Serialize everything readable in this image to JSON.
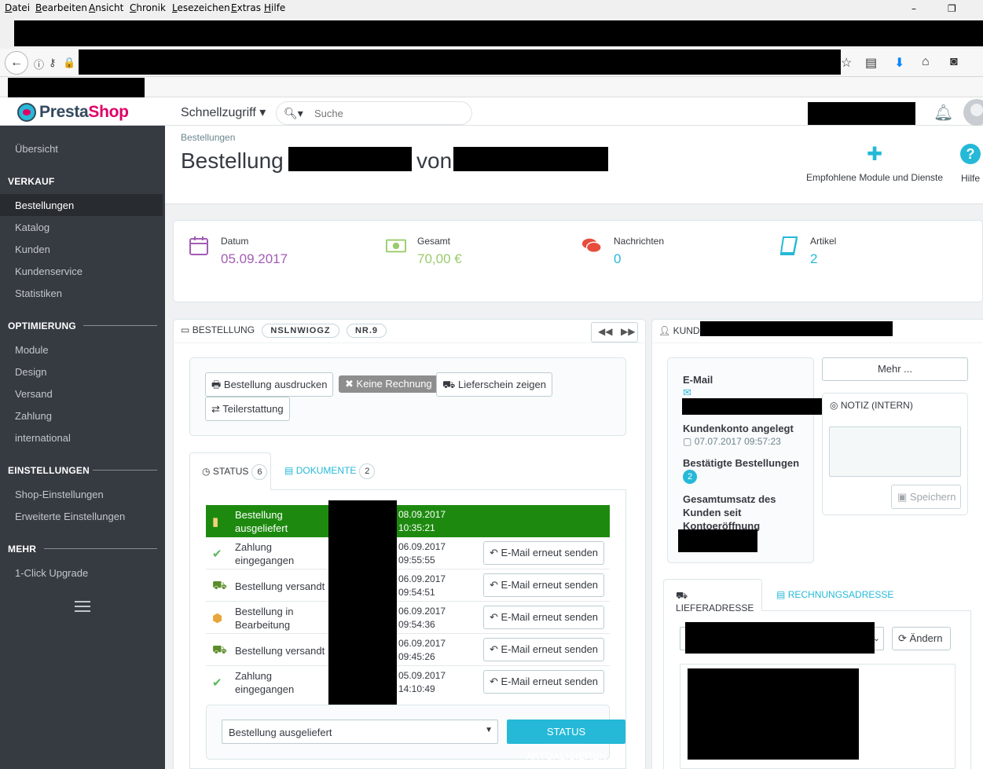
{
  "browser": {
    "menu": [
      "Datei",
      "Bearbeiten",
      "Ansicht",
      "Chronik",
      "Lesezeichen",
      "Extras",
      "Hilfe"
    ],
    "window_controls": [
      "–",
      "❐"
    ]
  },
  "header": {
    "logo_presta": "Presta",
    "logo_shop": "Shop",
    "quick_access": "Schnellzugriff ▾",
    "search_placeholder": "Suche"
  },
  "sidebar": {
    "overview": "Übersicht",
    "categories": [
      {
        "title": "VERKAUF",
        "items": [
          "Bestellungen",
          "Katalog",
          "Kunden",
          "Kundenservice",
          "Statistiken"
        ]
      },
      {
        "title": "OPTIMIERUNG",
        "items": [
          "Module",
          "Design",
          "Versand",
          "Zahlung",
          "international"
        ]
      },
      {
        "title": "EINSTELLUNGEN",
        "items": [
          "Shop-Einstellungen",
          "Erweiterte Einstellungen"
        ]
      },
      {
        "title": "MEHR",
        "items": [
          "1-Click Upgrade"
        ]
      }
    ],
    "active_item": "Bestellungen"
  },
  "page": {
    "breadcrumb": "Bestellungen",
    "title_prefix": "Bestellung",
    "title_von": "von",
    "toolbar": {
      "modules_label": "Empfohlene Module und Dienste",
      "help_label": "Hilfe"
    }
  },
  "kpis": [
    {
      "label": "Datum",
      "value": "05.09.2017",
      "color": "#a35cb5"
    },
    {
      "label": "Gesamt",
      "value": "70,00 €",
      "color": "#9acb6b"
    },
    {
      "label": "Nachrichten",
      "value": "0",
      "color": "#25b9d7"
    },
    {
      "label": "Artikel",
      "value": "2",
      "color": "#25b9d7"
    }
  ],
  "order_panel": {
    "heading": "BESTELLUNG",
    "reference": "NSLNWIOGZ",
    "number": "NR.9",
    "buttons": {
      "print": "Bestellung ausdrucken",
      "no_invoice": "Keine Rechnung",
      "delivery_slip": "Lieferschein zeigen",
      "refund": "Teilerstattung"
    },
    "tabs": {
      "status": "STATUS",
      "status_count": "6",
      "documents": "DOKUMENTE",
      "documents_count": "2"
    },
    "history": [
      {
        "name": "Bestellung ausgeliefert",
        "date": "08.09.2017",
        "time": "10:35:21",
        "icon": "package-icon",
        "delivered": true,
        "resend": ""
      },
      {
        "name": "Zahlung eingegangen",
        "date": "06.09.2017",
        "time": "09:55:55",
        "icon": "check-icon",
        "delivered": false,
        "resend": "E-Mail erneut senden"
      },
      {
        "name": "Bestellung versandt",
        "date": "06.09.2017",
        "time": "09:54:51",
        "icon": "truck-icon",
        "delivered": false,
        "resend": "E-Mail erneut senden"
      },
      {
        "name": "Bestellung in Bearbeitung",
        "date": "06.09.2017",
        "time": "09:54:36",
        "icon": "box-icon",
        "delivered": false,
        "resend": "E-Mail erneut senden"
      },
      {
        "name": "Bestellung versandt",
        "date": "06.09.2017",
        "time": "09:45:26",
        "icon": "truck-icon",
        "delivered": false,
        "resend": "E-Mail erneut senden"
      },
      {
        "name": "Zahlung eingegangen",
        "date": "05.09.2017",
        "time": "14:10:49",
        "icon": "check-icon",
        "delivered": false,
        "resend": "E-Mail erneut senden"
      }
    ],
    "status_select": "Bestellung ausgeliefert",
    "update_button": "STATUS AKTUALISIEREN"
  },
  "customer_panel": {
    "heading": "KUNDE",
    "more_button": "Mehr ...",
    "email_label": "E-Mail",
    "account_label": "Kundenkonto angelegt",
    "account_date": "07.07.2017 09:57:23",
    "orders_label": "Bestätigte Bestellungen",
    "orders_count": "2",
    "revenue_label": "Gesamtumsatz des Kunden seit Kontoeröffnung",
    "note_heading": "NOTIZ (INTERN)",
    "save_button": "Speichern",
    "tab_shipping": "LIEFERADRESSE",
    "tab_invoice": "RECHNUNGSADRESSE",
    "change_button": "Ändern"
  }
}
